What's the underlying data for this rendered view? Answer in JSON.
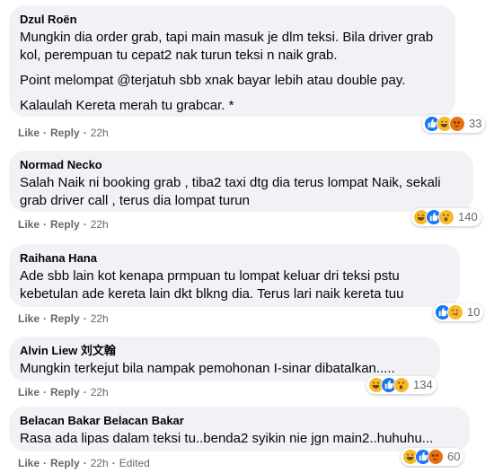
{
  "comments": [
    {
      "author": "Dzul Roën",
      "paragraphs": [
        "Mungkin dia order grab, tapi main masuk je dlm teksi. Bila driver grab kol, perempuan tu cepat2 nak turun teksi n naik grab.",
        "Point melompat @terjatuh sbb xnak bayar lebih atau double pay.",
        "Kalaulah Kereta merah tu grabcar. *"
      ],
      "like_label": "Like",
      "reply_label": "Reply",
      "time": "22h",
      "edited": "",
      "reaction_icons": [
        "like-icon",
        "haha-icon",
        "angry-icon"
      ],
      "reaction_count": "33"
    },
    {
      "author": "Normad Necko",
      "paragraphs": [
        "Salah Naik ni booking grab , tiba2 taxi dtg dia terus lompat Naik, sekali grab driver call , terus dia lompat turun"
      ],
      "like_label": "Like",
      "reply_label": "Reply",
      "time": "22h",
      "edited": "",
      "reaction_icons": [
        "haha-icon",
        "like-icon",
        "wow-icon"
      ],
      "reaction_count": "140"
    },
    {
      "author": "Raihana Hana",
      "paragraphs": [
        "Ade sbb lain kot kenapa prmpuan tu lompat keluar dri teksi pstu kebetulan ade kereta lain dkt blkng dia. Terus lari naik kereta tuu"
      ],
      "like_label": "Like",
      "reply_label": "Reply",
      "time": "22h",
      "edited": "",
      "reaction_icons": [
        "like-icon",
        "care-icon"
      ],
      "reaction_count": "10"
    },
    {
      "author": "Alvin Liew 刘文翰",
      "paragraphs": [
        "Mungkin terkejut bila nampak pemohonan I-sinar dibatalkan....."
      ],
      "like_label": "Like",
      "reply_label": "Reply",
      "time": "22h",
      "edited": "",
      "reaction_icons": [
        "haha-icon",
        "like-icon",
        "wow-icon"
      ],
      "reaction_count": "134"
    },
    {
      "author": "Belacan Bakar Belacan Bakar",
      "paragraphs": [
        "Rasa ada lipas dalam teksi tu..benda2 syikin nie jgn main2..huhuhu..."
      ],
      "like_label": "Like",
      "reply_label": "Reply",
      "time": "22h",
      "edited": "Edited",
      "reaction_icons": [
        "haha-icon",
        "like-icon",
        "angry-icon"
      ],
      "reaction_count": "60"
    }
  ],
  "colors": {
    "bubble_bg": "#f0f2f5",
    "meta_text": "#65676b",
    "like_blue": "#1877f2",
    "haha_yellow": "#f7b928",
    "angry_orange": "#e9710f"
  }
}
